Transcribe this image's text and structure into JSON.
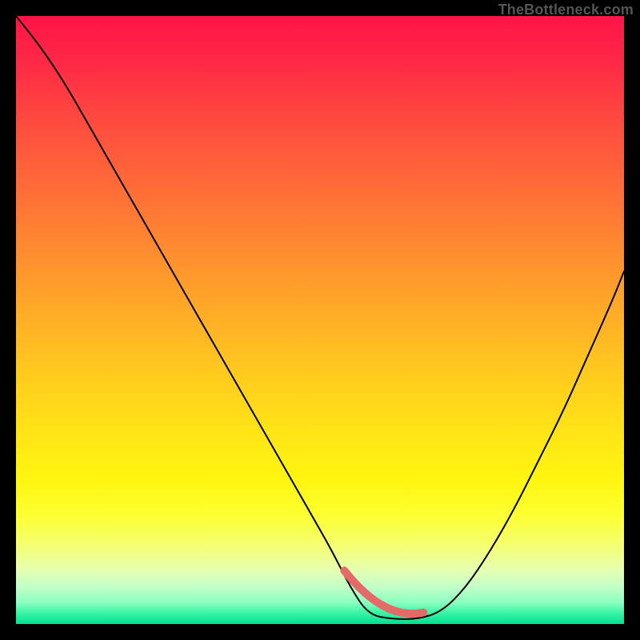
{
  "watermark": {
    "text": "TheBottleneck.com"
  },
  "colors": {
    "curve_stroke": "#000000",
    "bottom_marker": "#e46a68",
    "frame_bg": "#000000"
  },
  "chart_data": {
    "type": "line",
    "title": "",
    "xlabel": "",
    "ylabel": "",
    "xlim": [
      0,
      100
    ],
    "ylim": [
      0,
      100
    ],
    "series": [
      {
        "name": "bottleneck-curve",
        "x": [
          0,
          4,
          8,
          12,
          16,
          20,
          24,
          28,
          32,
          36,
          40,
          44,
          48,
          52,
          55,
          58,
          62,
          66,
          70,
          74,
          78,
          82,
          86,
          90,
          94,
          98,
          100
        ],
        "y": [
          100,
          95,
          89,
          82,
          75,
          68,
          61,
          54,
          47,
          40,
          33,
          26,
          19,
          12,
          6,
          1.5,
          0.8,
          0.8,
          2,
          6,
          12,
          19,
          27,
          35,
          44,
          53,
          58
        ]
      }
    ],
    "annotations": [
      {
        "name": "optimal-region",
        "x_start": 54,
        "x_end": 67,
        "y": 1,
        "note": "flat minimum highlighted in salmon"
      }
    ]
  }
}
